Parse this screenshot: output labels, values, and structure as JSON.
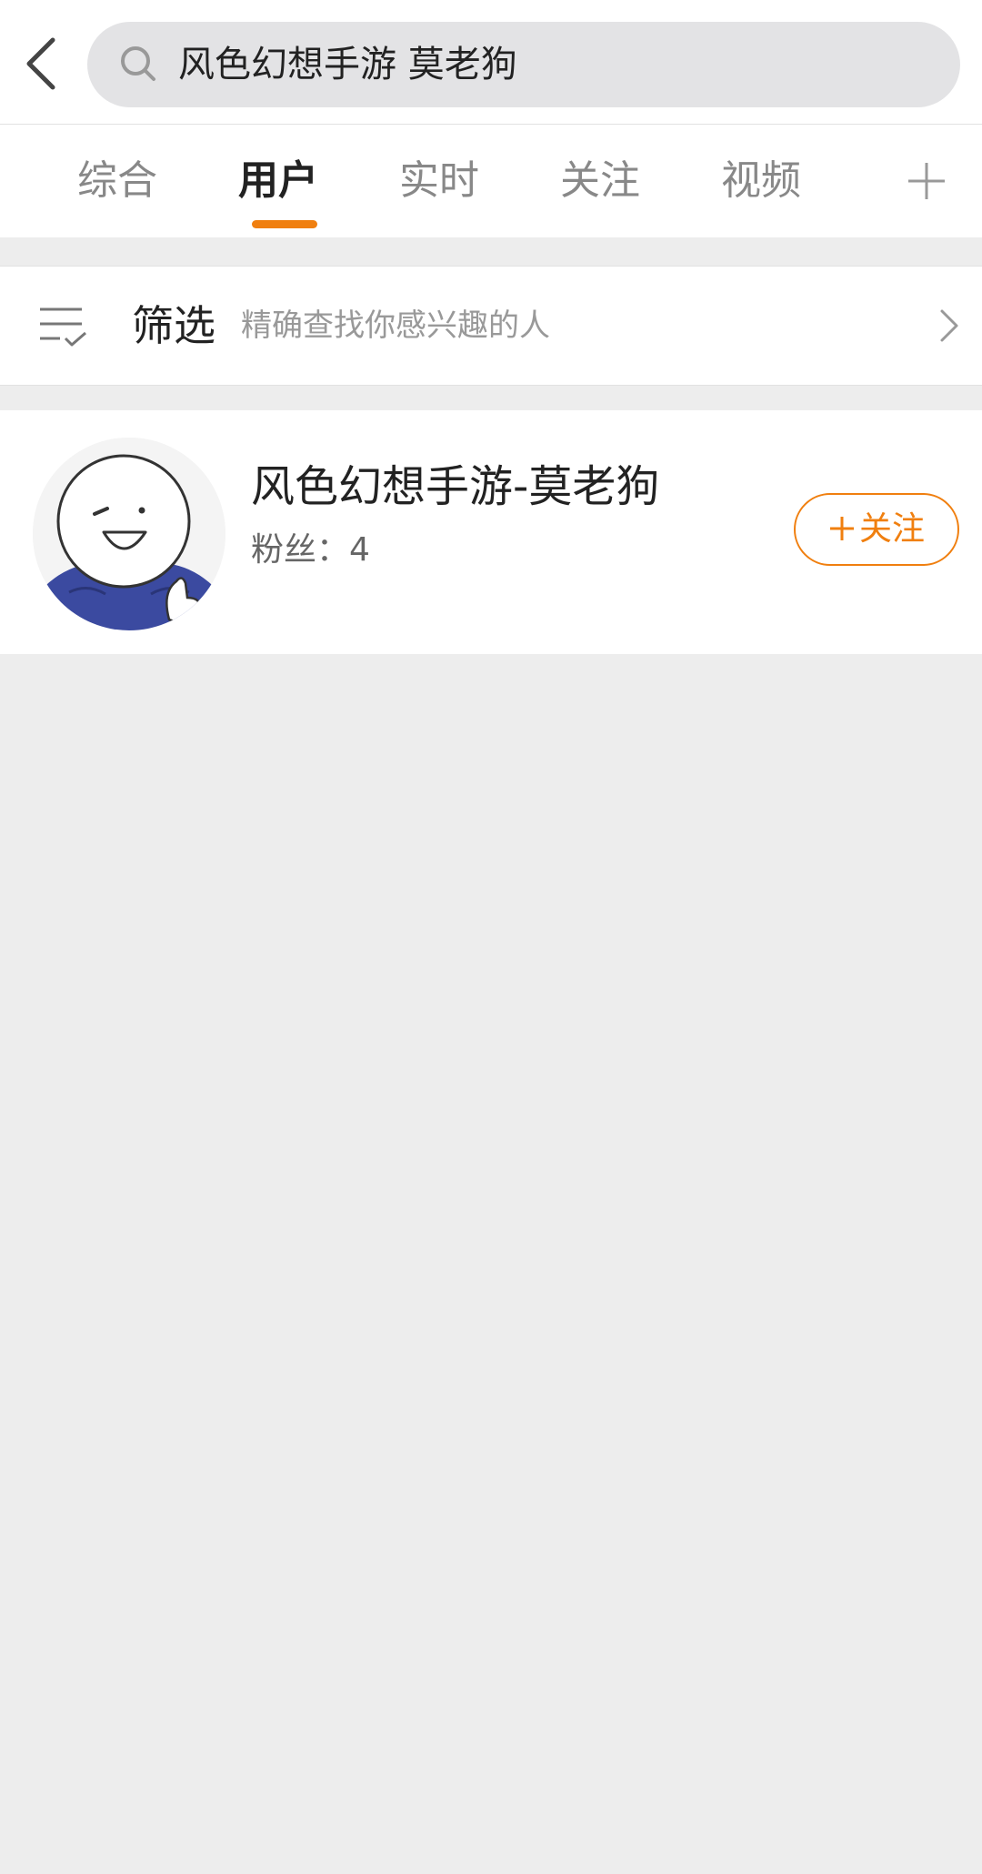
{
  "search": {
    "query": "风色幻想手游 莫老狗"
  },
  "tabs": [
    {
      "label": "综合"
    },
    {
      "label": "用户"
    },
    {
      "label": "实时"
    },
    {
      "label": "关注"
    },
    {
      "label": "视频"
    }
  ],
  "active_tab": "用户",
  "filter": {
    "title": "筛选",
    "hint": "精确查找你感兴趣的人"
  },
  "result": {
    "name": "风色幻想手游-莫老狗",
    "fans_label": "粉丝：",
    "fans_count": "4",
    "follow_label": "关注"
  },
  "icons": {
    "back": "back-arrow-icon",
    "search": "search-icon",
    "add_tab": "plus-icon",
    "filter": "filter-list-icon",
    "chevron": "chevron-right-icon",
    "follow_plus": "plus-icon"
  },
  "colors": {
    "accent": "#f07f0f",
    "background": "#ededed",
    "card": "#ffffff",
    "search_box": "#e3e3e5",
    "text_primary": "#222222",
    "text_secondary": "#888888"
  }
}
